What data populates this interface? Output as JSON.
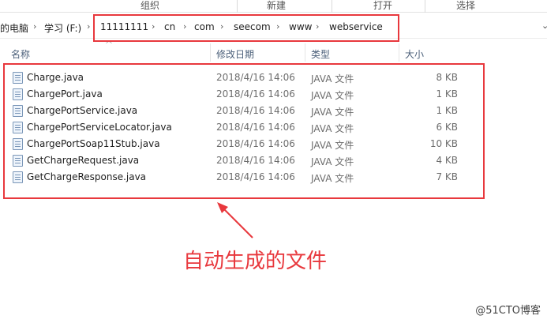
{
  "ribbon": {
    "groups": [
      "组织",
      "新建",
      "打开",
      "选择"
    ]
  },
  "address": {
    "crumbs": [
      "的电脑",
      "学习 (F:)",
      "11111111",
      "cn",
      "com",
      "seecom",
      "www",
      "webservice"
    ]
  },
  "columns": {
    "name": "名称",
    "modified": "修改日期",
    "type": "类型",
    "size": "大小"
  },
  "files": [
    {
      "name": "Charge.java",
      "modified": "2018/4/16 14:06",
      "type": "JAVA 文件",
      "size": "8 KB"
    },
    {
      "name": "ChargePort.java",
      "modified": "2018/4/16 14:06",
      "type": "JAVA 文件",
      "size": "1 KB"
    },
    {
      "name": "ChargePortService.java",
      "modified": "2018/4/16 14:06",
      "type": "JAVA 文件",
      "size": "1 KB"
    },
    {
      "name": "ChargePortServiceLocator.java",
      "modified": "2018/4/16 14:06",
      "type": "JAVA 文件",
      "size": "6 KB"
    },
    {
      "name": "ChargePortSoap11Stub.java",
      "modified": "2018/4/16 14:06",
      "type": "JAVA 文件",
      "size": "10 KB"
    },
    {
      "name": "GetChargeRequest.java",
      "modified": "2018/4/16 14:06",
      "type": "JAVA 文件",
      "size": "4 KB"
    },
    {
      "name": "GetChargeResponse.java",
      "modified": "2018/4/16 14:06",
      "type": "JAVA 文件",
      "size": "7 KB"
    }
  ],
  "annotation": {
    "text": "自动生成的文件",
    "color": "#e8383d"
  },
  "watermark": "@51CTO博客",
  "icons": {
    "breadcrumb_separator": "chevron-right-icon",
    "file": "java-file-icon"
  }
}
